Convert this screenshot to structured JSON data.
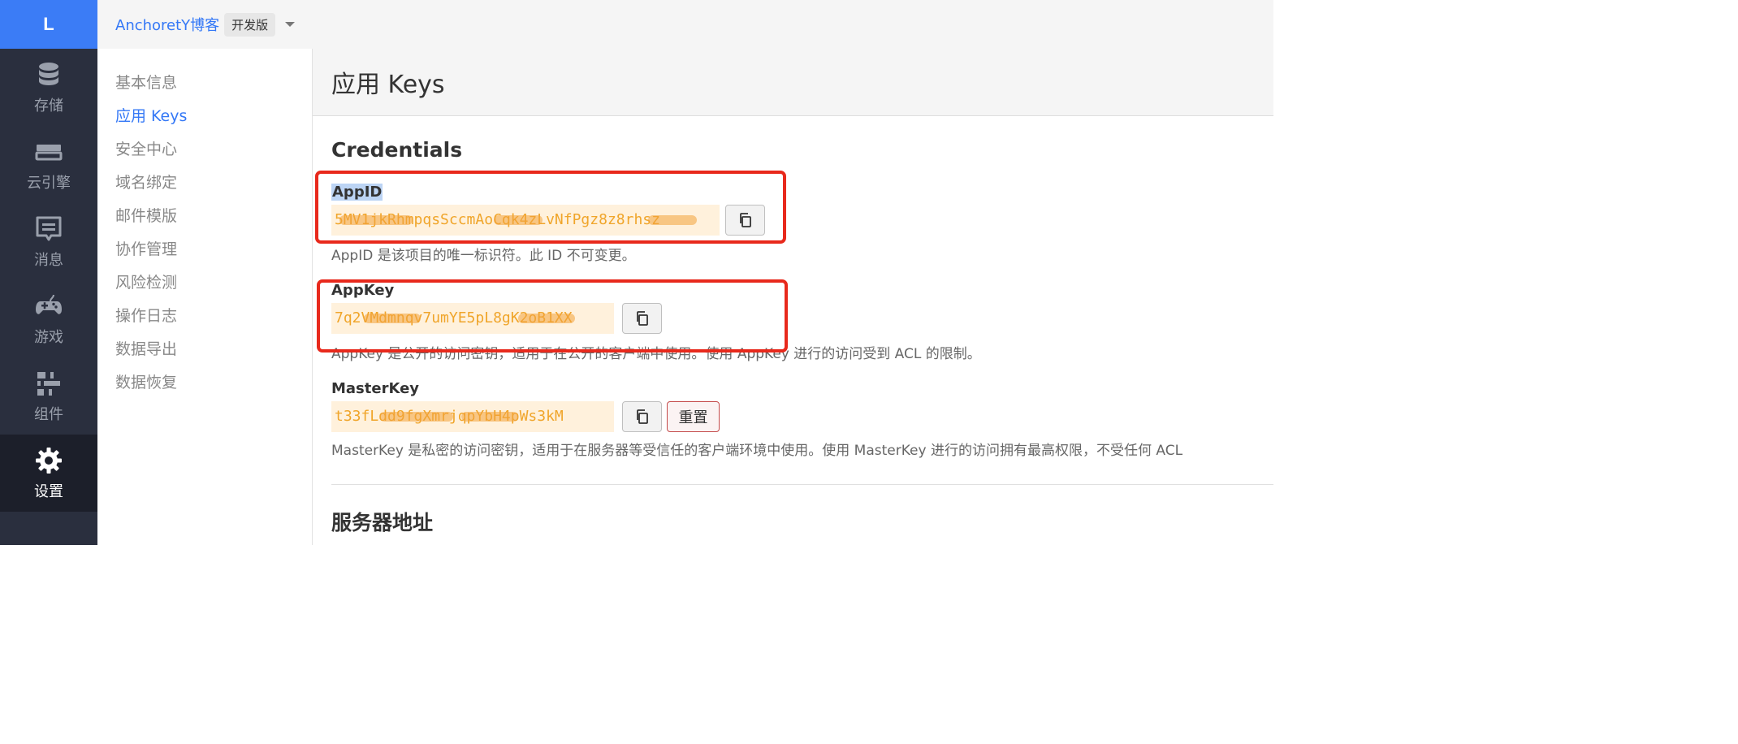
{
  "rail": {
    "logo": "L",
    "items": [
      {
        "label": "存储",
        "icon": "database-icon"
      },
      {
        "label": "云引擎",
        "icon": "server-icon"
      },
      {
        "label": "消息",
        "icon": "message-icon"
      },
      {
        "label": "游戏",
        "icon": "gamepad-icon"
      },
      {
        "label": "组件",
        "icon": "sliders-icon"
      },
      {
        "label": "设置",
        "icon": "gear-icon",
        "active": true
      }
    ]
  },
  "header": {
    "app_name": "AnchoretY博客",
    "edition": "开发版",
    "dropdown_icon": "chevron-down-icon"
  },
  "submenu": {
    "items": [
      {
        "label": "基本信息"
      },
      {
        "label": "应用 Keys",
        "active": true
      },
      {
        "label": "安全中心"
      },
      {
        "label": "域名绑定"
      },
      {
        "label": "邮件模版"
      },
      {
        "label": "协作管理"
      },
      {
        "label": "风险检测"
      },
      {
        "label": "操作日志"
      },
      {
        "label": "数据导出"
      },
      {
        "label": "数据恢复"
      }
    ]
  },
  "main": {
    "title": "应用 Keys",
    "credentials": {
      "title": "Credentials",
      "appid": {
        "label": "AppID",
        "value": "5MV1jkRhmpqsSccmAoCqk4zLvNfPgz8z8rhsz",
        "description": "AppID 是该项目的唯一标识符。此 ID 不可变更。"
      },
      "appkey": {
        "label": "AppKey",
        "value": "7q2VMdmnqv7umYE5pL8gK2oB1XX",
        "description": "AppKey 是公开的访问密钥，适用于在公开的客户端中使用。使用 AppKey 进行的访问受到 ACL 的限制。"
      },
      "masterkey": {
        "label": "MasterKey",
        "value": "t33fLdd9fgXmrjqpYbH4pWs3kM",
        "reset_label": "重置",
        "description": "MasterKey 是私密的访问密钥，适用于在服务器等受信任的客户端环境中使用。使用 MasterKey 进行的访问拥有最高权限，不受任何 ACL"
      }
    },
    "server_section": {
      "title": "服务器地址"
    }
  },
  "colors": {
    "accent": "#3478f6",
    "rail_bg": "#2a2f3e",
    "highlight_box": "#e8291c",
    "key_text": "#f0a52a"
  }
}
